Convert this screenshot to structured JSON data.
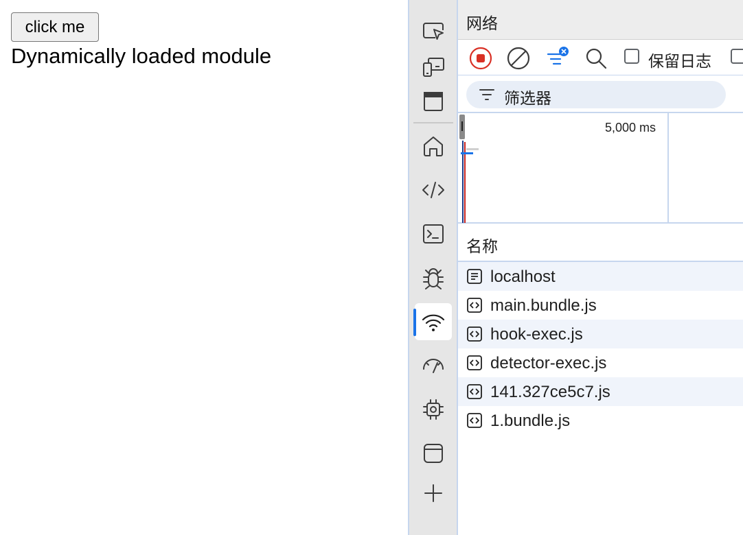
{
  "page": {
    "button_label": "click me",
    "module_text": "Dynamically loaded module"
  },
  "activity_bar": {
    "items": [
      {
        "icon": "inspect-icon"
      },
      {
        "icon": "device-emulation-icon"
      },
      {
        "icon": "browser-window-icon"
      },
      {
        "icon": "home-icon"
      },
      {
        "icon": "elements-code-icon"
      },
      {
        "icon": "console-icon"
      },
      {
        "icon": "debugger-bug-icon"
      },
      {
        "icon": "network-wifi-icon",
        "active": true
      },
      {
        "icon": "performance-gauge-icon"
      },
      {
        "icon": "memory-chip-icon"
      },
      {
        "icon": "application-icon"
      },
      {
        "icon": "add-tool-icon"
      }
    ]
  },
  "network": {
    "title": "网络",
    "toolbar": {
      "record_icon": "record-stop-icon",
      "clear_icon": "clear-icon",
      "filter_icon": "filter-icon",
      "search_icon": "search-icon",
      "preserve_log_label": "保留日志",
      "preserve_log_checked": false
    },
    "filter": {
      "placeholder": "筛选器"
    },
    "overview": {
      "tick_label": "5,000 ms"
    },
    "table": {
      "column_name": "名称",
      "rows": [
        {
          "name": "localhost",
          "type": "document"
        },
        {
          "name": "main.bundle.js",
          "type": "script"
        },
        {
          "name": "hook-exec.js",
          "type": "script"
        },
        {
          "name": "detector-exec.js",
          "type": "script"
        },
        {
          "name": "141.327ce5c7.js",
          "type": "script"
        },
        {
          "name": "1.bundle.js",
          "type": "script"
        }
      ]
    }
  },
  "colors": {
    "accent": "#1a73e8",
    "record_red": "#d93025",
    "sidebar_bg": "#e6e6e6",
    "header_bg": "#ededed",
    "border_blue": "#c6d6ee",
    "row_alt_bg": "#f0f4fb"
  }
}
